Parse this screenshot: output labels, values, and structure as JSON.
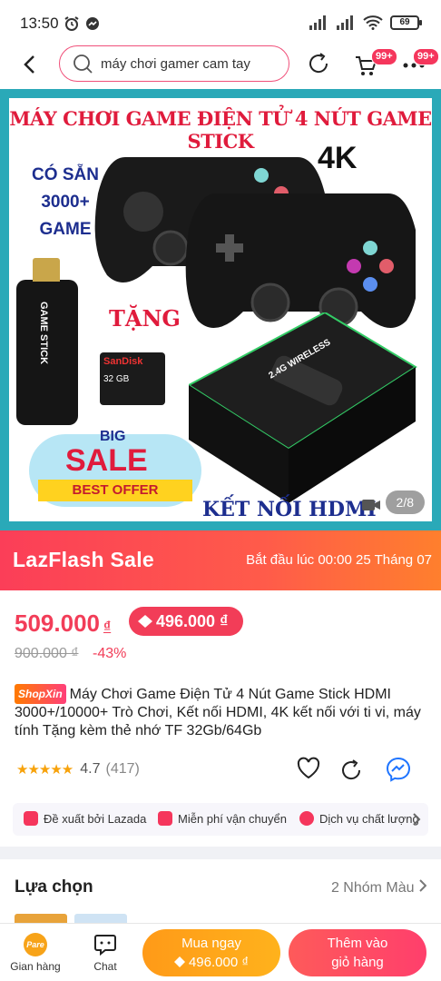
{
  "status": {
    "time": "13:50",
    "battery": "69"
  },
  "header": {
    "search_placeholder": "máy chơi gamer cam tay",
    "cart_badge": "99+",
    "more_badge": "99+"
  },
  "hero": {
    "title": "MÁY CHƠI GAME ĐIỆN TỬ 4 NÚT GAME STICK",
    "tag_4k": "4K",
    "side_line1": "CÓ SẴN",
    "side_line2": "3000+",
    "side_line3": "GAME",
    "gift": "TẶNG",
    "stick_label": "GAME STICK",
    "sd_brand": "SanDisk",
    "sd_size": "32 GB",
    "box_label": "2.4G WIRELESS",
    "sale_big": "BIG",
    "sale_word": "SALE",
    "sale_offer": "BEST OFFER",
    "connect": "KẾT NỐI HDMI",
    "counter": "2/8"
  },
  "flash": {
    "logo": "LazFlash Sale",
    "start": "Bắt đầu lúc 00:00 25 Tháng 07"
  },
  "price": {
    "current": "509.000",
    "currency": "₫",
    "voucher": "496.000 ₫",
    "old": "900.000 ₫",
    "discount": "-43%"
  },
  "product": {
    "shop_tag": "ShopXin",
    "title": "Máy Chơi Game Điện Tử 4 Nút Game Stick HDMI 3000+/10000+ Trò Chơi, Kết nối HDMI, 4K kết nối với ti vi, máy tính Tặng kèm thẻ nhớ TF 32Gb/64Gb",
    "rating": "4.7",
    "reviews": "(417)"
  },
  "features": [
    {
      "label": "Đề xuất bởi Lazada"
    },
    {
      "label": "Miễn phí vận chuyển"
    },
    {
      "label": "Dịch vụ chất lượng"
    }
  ],
  "choice": {
    "title": "Lựa chọn",
    "right": "2 Nhóm Màu"
  },
  "bottom": {
    "store": "Gian hàng",
    "chat": "Chat",
    "buy_label": "Mua ngay",
    "buy_price": "496.000 ₫",
    "cart_line1": "Thêm vào",
    "cart_line2": "giỏ hàng"
  },
  "colors": {
    "accent": "#f23d58",
    "teal_frame": "#2aa9b8",
    "buy": "#ffa41b"
  }
}
